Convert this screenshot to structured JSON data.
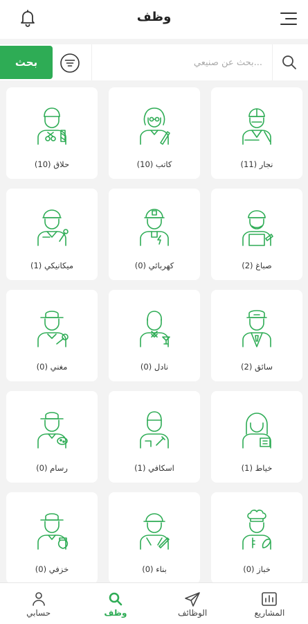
{
  "header": {
    "title": "وظف"
  },
  "search": {
    "button_label": "بحث",
    "placeholder": "...بحث عن صنيعي"
  },
  "categories": [
    {
      "label": "نجار (11)",
      "icon": "carpenter-icon"
    },
    {
      "label": "كاتب (10)",
      "icon": "writer-icon"
    },
    {
      "label": "حلاق (10)",
      "icon": "barber-icon"
    },
    {
      "label": "صباغ (2)",
      "icon": "painter-icon"
    },
    {
      "label": "كهربائي (0)",
      "icon": "electrician-icon"
    },
    {
      "label": "ميكانيكي (1)",
      "icon": "mechanic-icon"
    },
    {
      "label": "سائق (2)",
      "icon": "driver-icon"
    },
    {
      "label": "نادل (0)",
      "icon": "waiter-icon"
    },
    {
      "label": "مغني (0)",
      "icon": "singer-icon"
    },
    {
      "label": "خياط (1)",
      "icon": "tailor-icon"
    },
    {
      "label": "اسكافي (1)",
      "icon": "cobbler-icon"
    },
    {
      "label": "رسام (0)",
      "icon": "artist-icon"
    },
    {
      "label": "خباز (0)",
      "icon": "baker-icon"
    },
    {
      "label": "بناء (0)",
      "icon": "builder-icon"
    },
    {
      "label": "خزفي (0)",
      "icon": "potter-icon"
    }
  ],
  "nav": [
    {
      "label": "المشاريع",
      "icon": "projects-icon",
      "active": false
    },
    {
      "label": "الوظائف",
      "icon": "send-icon",
      "active": false
    },
    {
      "label": "وظف",
      "icon": "search-icon",
      "active": true
    },
    {
      "label": "حسابي",
      "icon": "user-icon",
      "active": false
    }
  ],
  "colors": {
    "accent": "#2eac55",
    "background": "#f3f3f3"
  }
}
